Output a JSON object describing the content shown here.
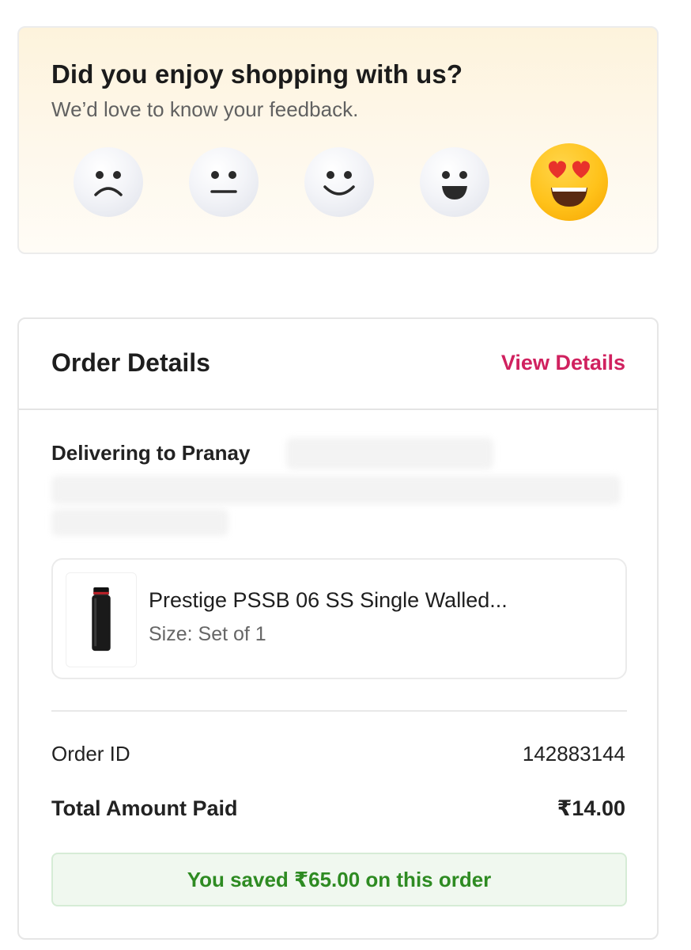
{
  "feedback": {
    "title": "Did you enjoy shopping with us?",
    "subtitle": "We’d love to know your feedback.",
    "ratings": [
      "sad-face-icon",
      "neutral-face-icon",
      "smile-face-icon",
      "grin-face-icon",
      "heart-eyes-face-icon"
    ]
  },
  "order": {
    "title": "Order Details",
    "view_details": "View Details",
    "delivering_to": "Delivering to Pranay",
    "product": {
      "name": "Prestige PSSB 06 SS Single Walled...",
      "size": "Size: Set of 1"
    },
    "order_id_label": "Order ID",
    "order_id_value": "142883144",
    "total_label": "Total Amount Paid",
    "total_value": "₹14.00",
    "savings_text": "You saved ₹65.00 on this order"
  },
  "colors": {
    "accent": "#d0215f",
    "savings_green": "#2e8b22"
  }
}
